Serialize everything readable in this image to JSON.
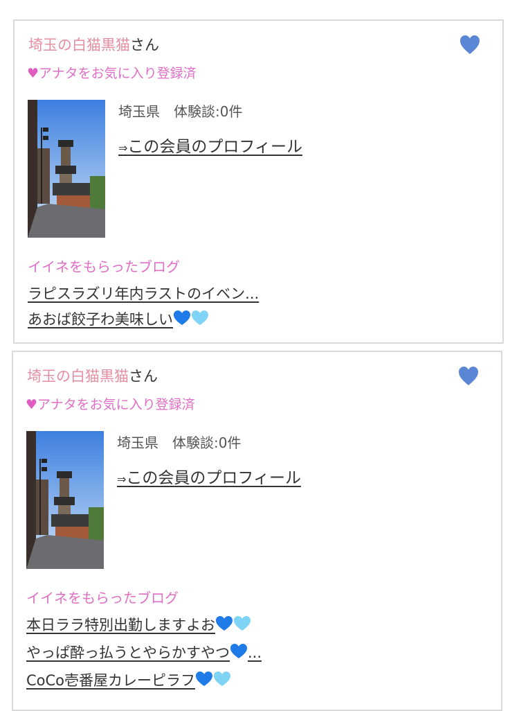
{
  "cards": [
    {
      "name": "埼玉の白猫黒猫",
      "suffix": "さん",
      "fav_mark": "♥",
      "fav_text": "アナタをお気に入り登録済",
      "info": "埼玉県　体験談:0件",
      "profile_arrow": "⇒",
      "profile_link": "この会員のプロフィール",
      "blog_heading": "イイネをもらったブログ",
      "blogs": [
        {
          "text": "ラピスラズリ年内ラストのイベン..."
        },
        {
          "text": "あおば餃子わ美味しい",
          "emoji": [
            "blue-heart",
            "light-blue-heart"
          ]
        }
      ]
    },
    {
      "name": "埼玉の白猫黒猫",
      "suffix": "さん",
      "fav_mark": "♥",
      "fav_text": "アナタをお気に入り登録済",
      "info": "埼玉県　体験談:0件",
      "profile_arrow": "⇒",
      "profile_link": "この会員のプロフィール",
      "blog_heading": "イイネをもらったブログ",
      "blogs": [
        {
          "text": "本日ララ特別出勤しますよお",
          "emoji": [
            "blue-heart",
            "light-blue-heart"
          ]
        },
        {
          "text": "やっぱ酔っ払うとやらかすやつ",
          "emoji": [
            "blue-heart"
          ],
          "tail": "..."
        },
        {
          "text": "CoCo壱番屋カレーピラフ",
          "emoji": [
            "blue-heart",
            "light-blue-heart"
          ]
        }
      ]
    }
  ],
  "colors": {
    "name_pink": "#e58ea0",
    "fav_pink": "#e06ec6",
    "heart_blue": "#5b86d6",
    "emoji_blue": "#1e7be8",
    "emoji_light_blue": "#7fd3f5"
  }
}
